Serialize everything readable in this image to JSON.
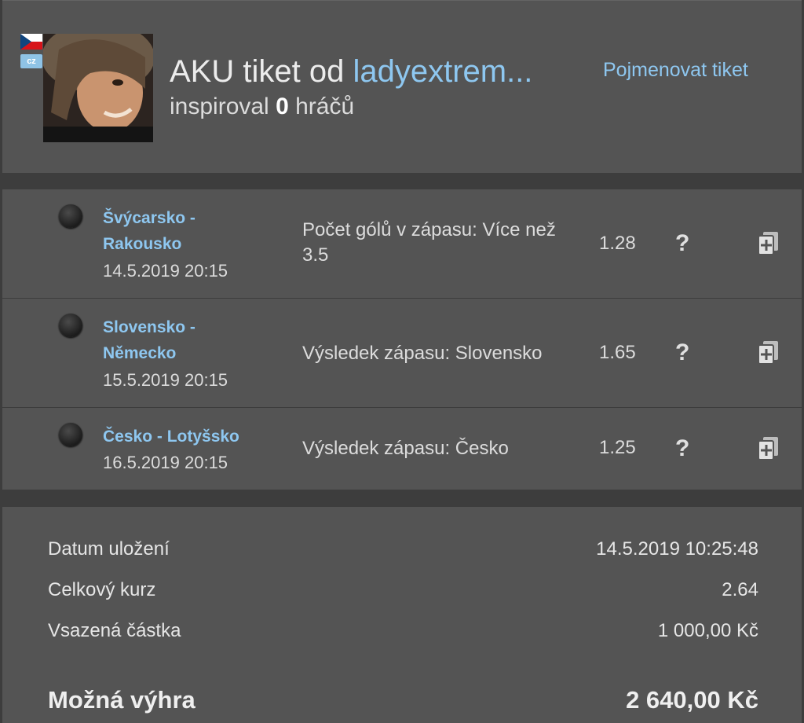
{
  "header": {
    "title_prefix": "AKU tiket od",
    "username": "ladyextrem...",
    "subtitle_prefix": "inspiroval",
    "inspired_count": "0",
    "subtitle_suffix": "hráčů",
    "rename_link": "Pojmenovat tiket",
    "country_badge": "cz"
  },
  "matches": [
    {
      "line1": "Švýcarsko -",
      "line2": "Rakousko",
      "date": "14.5.2019 20:15",
      "bet": "Počet gólů v zápasu: Více než 3.5",
      "odds": "1.28",
      "help": "?"
    },
    {
      "line1": "Slovensko -",
      "line2": "Německo",
      "date": "15.5.2019 20:15",
      "bet": "Výsledek zápasu: Slovensko",
      "odds": "1.65",
      "help": "?"
    },
    {
      "line1": "Česko - Lotyšsko",
      "line2": "",
      "date": "16.5.2019 20:15",
      "bet": "Výsledek zápasu: Česko",
      "odds": "1.25",
      "help": "?"
    }
  ],
  "summary": {
    "saved_label": "Datum uložení",
    "saved_value": "14.5.2019 10:25:48",
    "total_odds_label": "Celkový kurz",
    "total_odds_value": "2.64",
    "stake_label": "Vsazená částka",
    "stake_value": "1 000,00 Kč",
    "win_label": "Možná výhra",
    "win_value": "2 640,00 Kč"
  },
  "colors": {
    "link": "#8ec7f0",
    "panel": "#545454",
    "background": "#3d3d3d"
  }
}
